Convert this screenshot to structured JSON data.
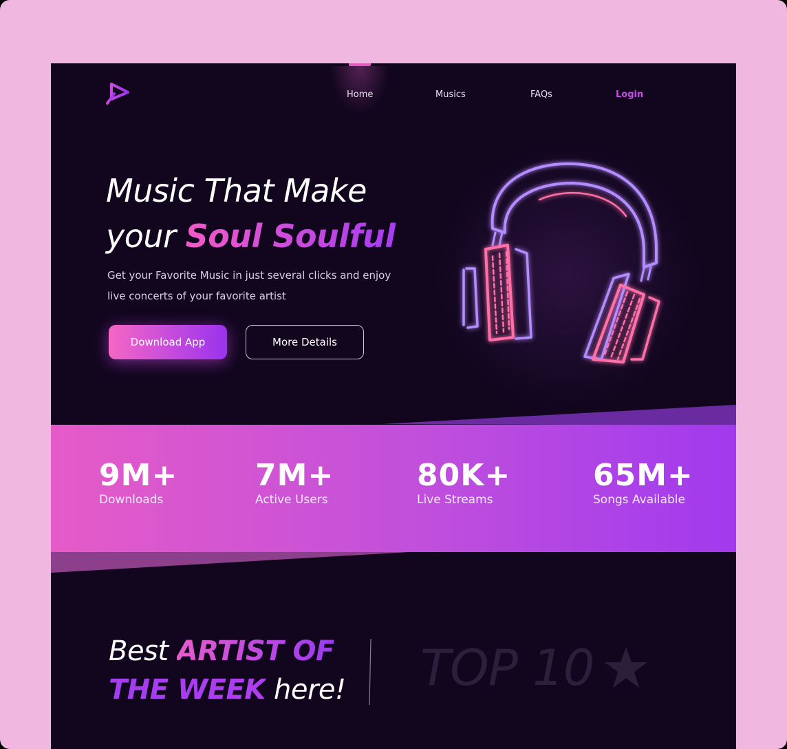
{
  "nav": {
    "home": "Home",
    "musics": "Musics",
    "faqs": "FAQs",
    "login": "Login"
  },
  "hero": {
    "title_line1": "Music That Make",
    "title_line2_prefix": "your ",
    "title_highlight": "Soul Soulful",
    "subtitle_line1": "Get your Favorite Music in just several clicks and enjoy",
    "subtitle_line2": "live concerts of your favorite artist",
    "download_button": "Download App",
    "more_button": "More Details"
  },
  "stats": [
    {
      "value": "9M+",
      "label": "Downloads"
    },
    {
      "value": "7M+",
      "label": "Active Users"
    },
    {
      "value": "80K+",
      "label": "Live Streams"
    },
    {
      "value": "65M+",
      "label": "Songs Available"
    }
  ],
  "artists": {
    "title_prefix": "Best ",
    "title_highlight_1": "ARTIST OF",
    "title_highlight_2": "THE WEEK",
    "title_suffix": " here!",
    "top_label": "TOP 10"
  },
  "icons": {
    "logo": "play-logo-icon",
    "headphones": "neon-headphones-illustration",
    "star": "star-icon"
  },
  "colors": {
    "accent_pink": "#f25ac6",
    "accent_purple": "#9a33ee",
    "background": "#12061f",
    "frame": "#f0b8e0"
  }
}
